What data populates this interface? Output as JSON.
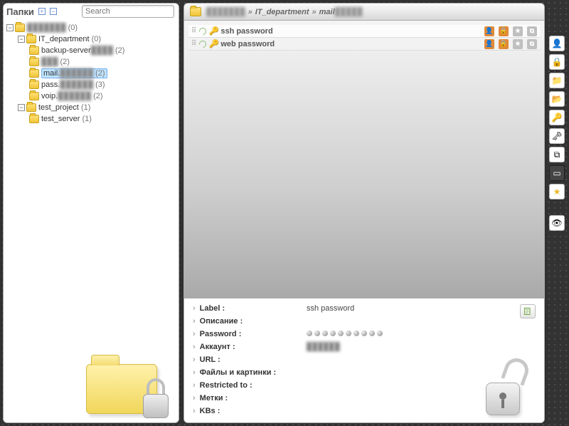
{
  "sidebar": {
    "title": "Папки",
    "search_placeholder": "Search",
    "tree": {
      "root": {
        "label_blur": "███████",
        "count": "(0)"
      },
      "dept": {
        "label": "IT_department",
        "count": "(0)"
      },
      "backup": {
        "label": "backup-server",
        "blur": "████",
        "count": "(2)"
      },
      "blank": {
        "blur": "███",
        "count": "(2)"
      },
      "mail": {
        "label": "mail.",
        "blur": "██████",
        "count": "(2)"
      },
      "pass": {
        "label": "pass.",
        "blur": "██████",
        "count": "(3)"
      },
      "voip": {
        "label": "voip.",
        "blur": "██████",
        "count": "(2)"
      },
      "test_project": {
        "label": "test_project",
        "count": "(1)"
      },
      "test_server": {
        "label": "test_server",
        "count": "(1)"
      }
    }
  },
  "breadcrumb": {
    "root_blur": "███████",
    "sep": "»",
    "p1": "IT_department",
    "p2": "mail",
    "p2_blur": "█████"
  },
  "items": {
    "row0": {
      "label": "ssh password"
    },
    "row1": {
      "label": "web password"
    }
  },
  "detail": {
    "k_label": "Label :",
    "v_label": "ssh password",
    "k_desc": "Описание :",
    "k_pass": "Password :",
    "k_acct": "Аккаунт :",
    "v_acct_blur": "██████",
    "k_url": "URL :",
    "k_files": "Файлы и картинки :",
    "k_restr": "Restricted to :",
    "k_tags": "Метки :",
    "k_kbs": "KBs :"
  },
  "icons": {
    "person": "👤",
    "lock": "🔒",
    "folder_new": "📁",
    "folder_edit": "📂",
    "key_new": "🔑",
    "key_del": "🗝",
    "copy": "⧉",
    "screen": "▭",
    "star": "★",
    "eye": "👁"
  }
}
